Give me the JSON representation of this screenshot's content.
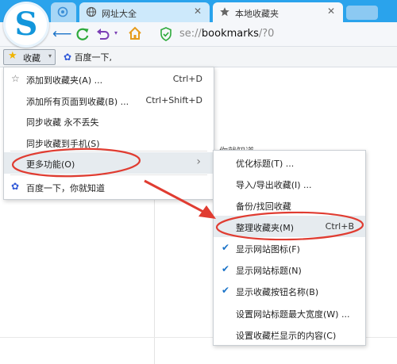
{
  "colors": {
    "accent": "#2aa3ec",
    "annotation": "#e03c31"
  },
  "browser": {
    "logo_letter": "S",
    "tabs": [
      {
        "label": "",
        "icon": "sougou-tab-icon"
      },
      {
        "label": "网址大全",
        "icon": "globe-icon"
      },
      {
        "label": "本地收藏夹",
        "icon": "star-icon"
      }
    ],
    "address": {
      "scheme": "se://",
      "path": "bookmarks",
      "suffix": "/?0"
    }
  },
  "bookmarks_bar": {
    "favorites_label": "收藏",
    "items": [
      {
        "label": "百度一下,"
      }
    ]
  },
  "page": {
    "text": "度一下，你就知道"
  },
  "main_menu": {
    "items": [
      {
        "label": "添加到收藏夹(A) ...",
        "shortcut": "Ctrl+D"
      },
      {
        "label": "添加所有页面到收藏(B) ...",
        "shortcut": "Ctrl+Shift+D"
      },
      {
        "label": "同步收藏 永不丢失"
      },
      {
        "label": "同步收藏到手机(S)"
      },
      {
        "label": "更多功能(O)"
      },
      {
        "label": "百度一下，你就知道"
      }
    ]
  },
  "sub_menu": {
    "items": [
      {
        "label": "优化标题(T) ..."
      },
      {
        "label": "导入/导出收藏(I) ..."
      },
      {
        "label": "备份/找回收藏"
      },
      {
        "label": "整理收藏夹(M)",
        "shortcut": "Ctrl+B"
      },
      {
        "label": "显示网站图标(F)",
        "checked": true
      },
      {
        "label": "显示网站标题(N)",
        "checked": true
      },
      {
        "label": "显示收藏按钮名称(B)",
        "checked": true
      },
      {
        "label": "设置网站标题最大宽度(W) ..."
      },
      {
        "label": "设置收藏栏显示的内容(C)"
      }
    ]
  }
}
